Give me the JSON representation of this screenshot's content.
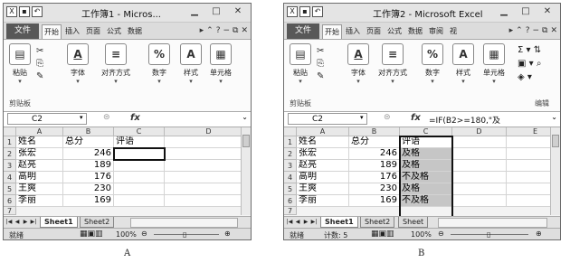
{
  "windowA": {
    "title": "工作簿1 - Micros...",
    "tabs": [
      "文件",
      "开始",
      "插入",
      "页面",
      "公式",
      "数据"
    ],
    "ribbon": {
      "paste": "粘贴",
      "font": "字体",
      "align": "对齐方式",
      "number": "数字",
      "style": "样式",
      "cells": "单元格",
      "clipboard_group": "剪贴板"
    },
    "namebox": "C2",
    "formula": "",
    "columns": [
      "A",
      "B",
      "C",
      "D"
    ],
    "rows": [
      {
        "n": "1",
        "a": "姓名",
        "b": "总分",
        "c": "评语"
      },
      {
        "n": "2",
        "a": "张宏",
        "b": "246",
        "c": ""
      },
      {
        "n": "3",
        "a": "赵亮",
        "b": "189",
        "c": ""
      },
      {
        "n": "4",
        "a": "高明",
        "b": "176",
        "c": ""
      },
      {
        "n": "5",
        "a": "王爽",
        "b": "230",
        "c": ""
      },
      {
        "n": "6",
        "a": "李丽",
        "b": "169",
        "c": ""
      }
    ],
    "row7": "7",
    "sheet1": "Sheet1",
    "sheet2": "Sheet2",
    "status_left": "就绪",
    "zoom": "100%"
  },
  "windowB": {
    "title": "工作簿2 - Microsoft Excel",
    "tabs": [
      "文件",
      "开始",
      "插入",
      "页面",
      "公式",
      "数据",
      "审阅",
      "视"
    ],
    "ribbon": {
      "paste": "粘贴",
      "font": "字体",
      "align": "对齐方式",
      "number": "数字",
      "style": "样式",
      "cells": "单元格",
      "clipboard_group": "剪贴板",
      "edit_group": "编辑"
    },
    "namebox": "C2",
    "formula": "=IF(B2>=180,\"及",
    "columns": [
      "A",
      "B",
      "C",
      "D",
      "E"
    ],
    "rows": [
      {
        "n": "1",
        "a": "姓名",
        "b": "总分",
        "c": "评语"
      },
      {
        "n": "2",
        "a": "张宏",
        "b": "246",
        "c": "及格"
      },
      {
        "n": "3",
        "a": "赵亮",
        "b": "189",
        "c": "及格"
      },
      {
        "n": "4",
        "a": "高明",
        "b": "176",
        "c": "不及格"
      },
      {
        "n": "5",
        "a": "王爽",
        "b": "230",
        "c": "及格"
      },
      {
        "n": "6",
        "a": "李丽",
        "b": "169",
        "c": "不及格"
      }
    ],
    "row7": "7",
    "sheet1": "Sheet1",
    "sheet2": "Sheet2",
    "sheet3": "Sheet",
    "status_left": "就绪",
    "status_count": "计数: 5",
    "zoom": "100%"
  },
  "captions": {
    "a": "A",
    "b": "B"
  },
  "colors": {
    "selected_fill": "#c6c6c6",
    "file_tab": "#585858"
  }
}
